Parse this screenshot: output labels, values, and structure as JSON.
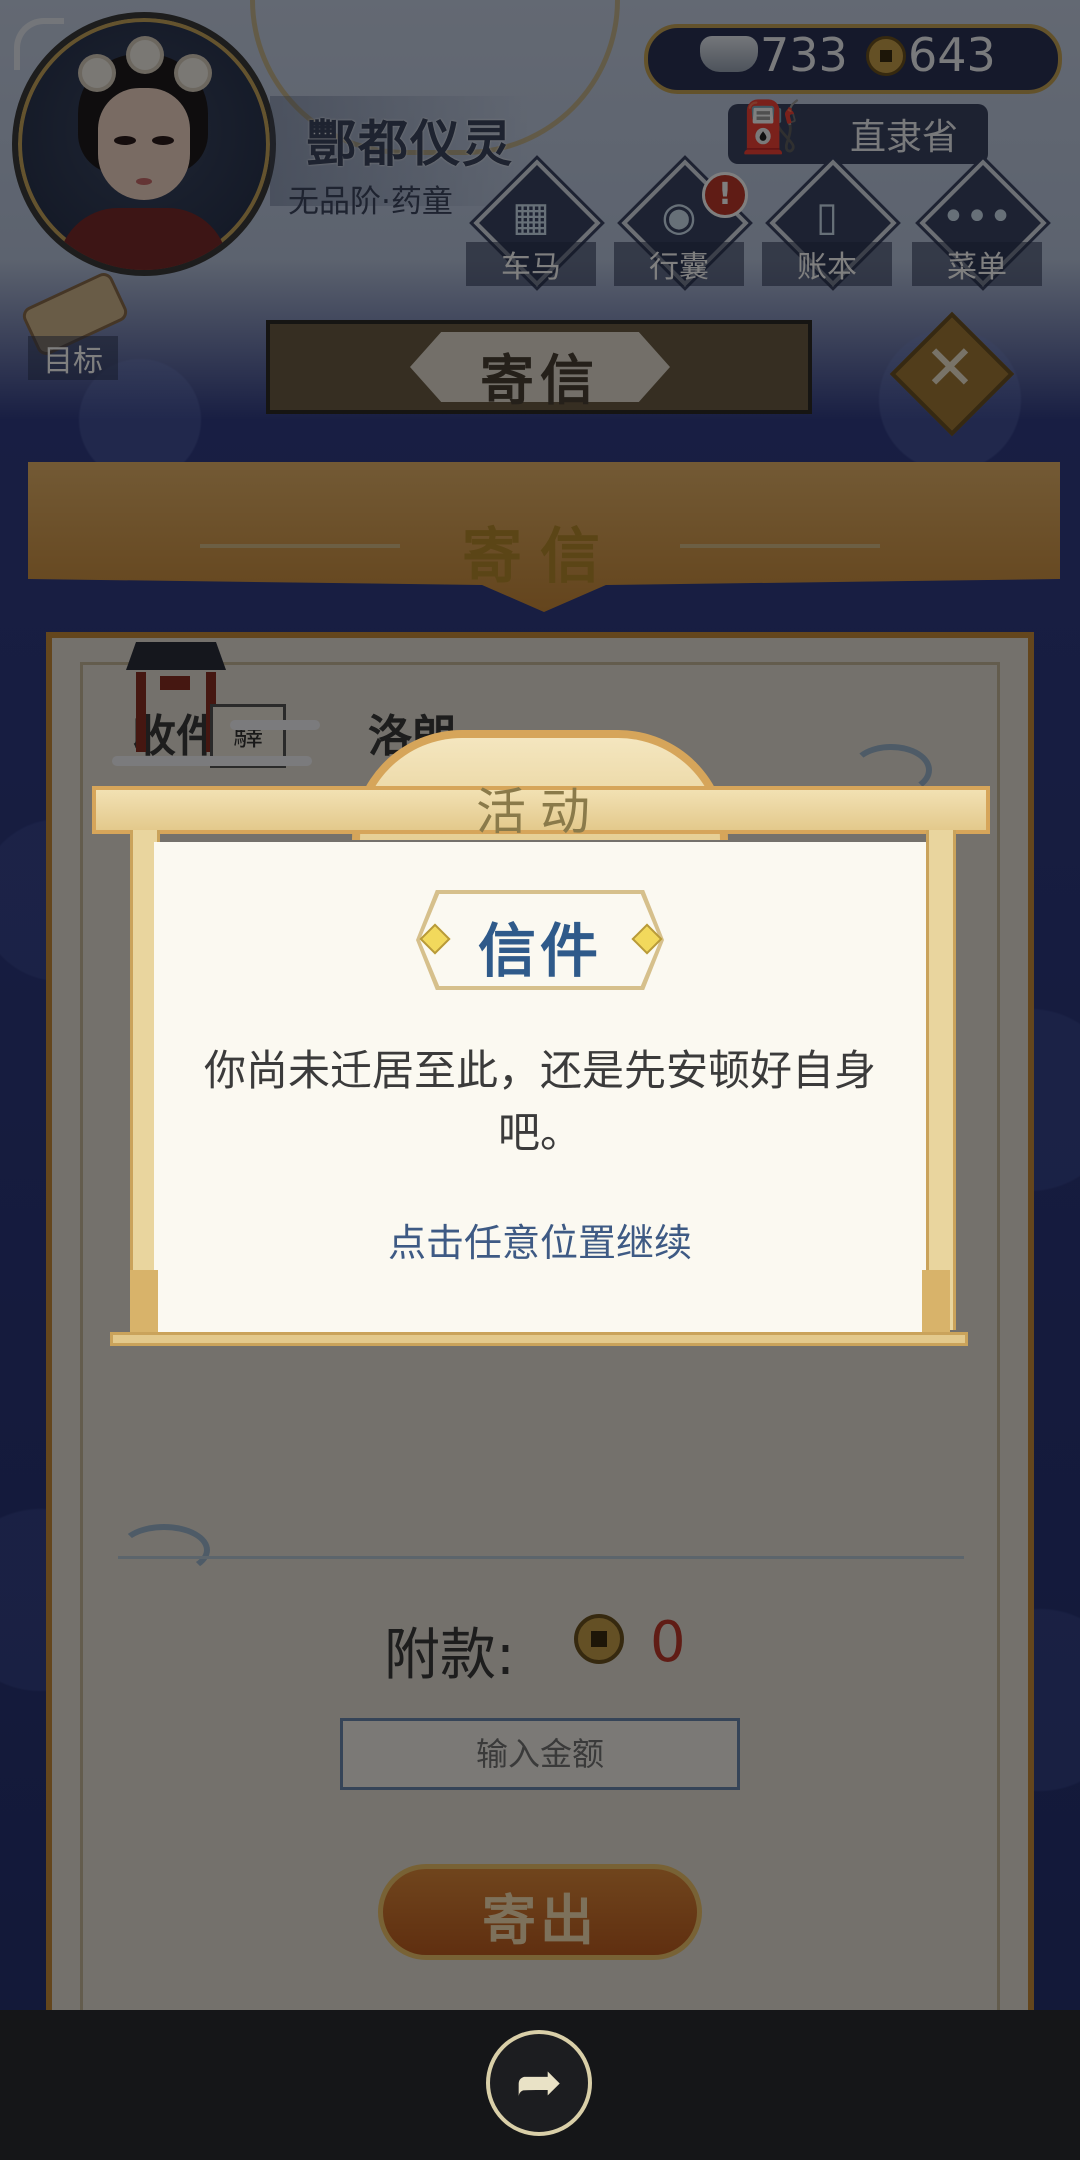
{
  "header": {
    "player_name": "酆都仪灵",
    "player_rank": "无品阶·药童",
    "silver": "733",
    "coins": "643",
    "region": "直隶省",
    "goal_label": "目标"
  },
  "nav": [
    {
      "label": "车马",
      "icon": "carriage-icon",
      "badge": ""
    },
    {
      "label": "行囊",
      "icon": "bag-icon",
      "badge": "!"
    },
    {
      "label": "账本",
      "icon": "ledger-icon",
      "badge": ""
    },
    {
      "label": "菜单",
      "icon": "menu-dots-icon",
      "badge": ""
    }
  ],
  "page_title": "寄信",
  "panel": {
    "title": "寄信",
    "recipient_label": "收件",
    "recipient_value": "洛朗",
    "post_box_char": "驛",
    "deposit_label": "附款:",
    "deposit_value": "0",
    "amount_placeholder": "输入金额",
    "send_label": "寄出"
  },
  "modal": {
    "tab": "活动",
    "title": "信件",
    "message": "你尚未迁居至此，还是先安顿好自身吧。",
    "hint": "点击任意位置继续"
  },
  "colors": {
    "accent_gold": "#c9a04a",
    "modal_title_blue": "#2f5a8a",
    "deposit_red": "#c0392b"
  }
}
